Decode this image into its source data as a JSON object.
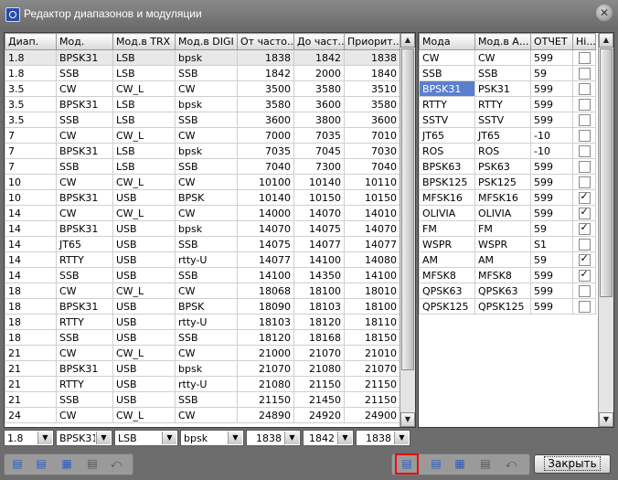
{
  "window": {
    "title": "Редактор диапазонов и модуляции"
  },
  "left_table": {
    "columns": [
      "Диап.",
      "Мод.",
      "Мод.в TRX",
      "Мод.в DIGI",
      "От часто...",
      "До част...",
      "Приорит..."
    ],
    "rows": [
      [
        "1.8",
        "BPSK31",
        "LSB",
        "bpsk",
        "1838",
        "1842",
        "1838"
      ],
      [
        "1.8",
        "SSB",
        "LSB",
        "SSB",
        "1842",
        "2000",
        "1840"
      ],
      [
        "3.5",
        "CW",
        "CW_L",
        "CW",
        "3500",
        "3580",
        "3510"
      ],
      [
        "3.5",
        "BPSK31",
        "LSB",
        "bpsk",
        "3580",
        "3600",
        "3580"
      ],
      [
        "3.5",
        "SSB",
        "LSB",
        "SSB",
        "3600",
        "3800",
        "3600"
      ],
      [
        "7",
        "CW",
        "CW_L",
        "CW",
        "7000",
        "7035",
        "7010"
      ],
      [
        "7",
        "BPSK31",
        "LSB",
        "bpsk",
        "7035",
        "7045",
        "7030"
      ],
      [
        "7",
        "SSB",
        "LSB",
        "SSB",
        "7040",
        "7300",
        "7040"
      ],
      [
        "10",
        "CW",
        "CW_L",
        "CW",
        "10100",
        "10140",
        "10110"
      ],
      [
        "10",
        "BPSK31",
        "USB",
        "BPSK",
        "10140",
        "10150",
        "10150"
      ],
      [
        "14",
        "CW",
        "CW_L",
        "CW",
        "14000",
        "14070",
        "14010"
      ],
      [
        "14",
        "BPSK31",
        "USB",
        "bpsk",
        "14070",
        "14075",
        "14070"
      ],
      [
        "14",
        "JT65",
        "USB",
        "SSB",
        "14075",
        "14077",
        "14077"
      ],
      [
        "14",
        "RTTY",
        "USB",
        "rtty-U",
        "14077",
        "14100",
        "14080"
      ],
      [
        "14",
        "SSB",
        "USB",
        "SSB",
        "14100",
        "14350",
        "14100"
      ],
      [
        "18",
        "CW",
        "CW_L",
        "CW",
        "18068",
        "18100",
        "18010"
      ],
      [
        "18",
        "BPSK31",
        "USB",
        "BPSK",
        "18090",
        "18103",
        "18100"
      ],
      [
        "18",
        "RTTY",
        "USB",
        "rtty-U",
        "18103",
        "18120",
        "18110"
      ],
      [
        "18",
        "SSB",
        "USB",
        "SSB",
        "18120",
        "18168",
        "18150"
      ],
      [
        "21",
        "CW",
        "CW_L",
        "CW",
        "21000",
        "21070",
        "21010"
      ],
      [
        "21",
        "BPSK31",
        "USB",
        "bpsk",
        "21070",
        "21080",
        "21070"
      ],
      [
        "21",
        "RTTY",
        "USB",
        "rtty-U",
        "21080",
        "21150",
        "21150"
      ],
      [
        "21",
        "SSB",
        "USB",
        "SSB",
        "21150",
        "21450",
        "21150"
      ],
      [
        "24",
        "CW",
        "CW_L",
        "CW",
        "24890",
        "24920",
        "24900"
      ]
    ],
    "edit_row": {
      "band": "1.8",
      "mode": "BPSK31",
      "trx_mode": "LSB",
      "digi_mode": "bpsk",
      "from": "1838",
      "to": "1842",
      "priority": "1838"
    }
  },
  "right_table": {
    "columns": [
      "Мода",
      "Мод.в А...",
      "ОТЧЕТ",
      "Hi..."
    ],
    "rows": [
      {
        "mode": "CW",
        "alias": "CW",
        "report": "599",
        "checked": false
      },
      {
        "mode": "SSB",
        "alias": "SSB",
        "report": "59",
        "checked": false
      },
      {
        "mode": "BPSK31",
        "alias": "PSK31",
        "report": "599",
        "checked": false
      },
      {
        "mode": "RTTY",
        "alias": "RTTY",
        "report": "599",
        "checked": false
      },
      {
        "mode": "SSTV",
        "alias": "SSTV",
        "report": "599",
        "checked": false
      },
      {
        "mode": "JT65",
        "alias": "JT65",
        "report": "-10",
        "checked": false
      },
      {
        "mode": "ROS",
        "alias": "ROS",
        "report": "-10",
        "checked": false
      },
      {
        "mode": "BPSK63",
        "alias": "PSK63",
        "report": "599",
        "checked": false
      },
      {
        "mode": "BPSK125",
        "alias": "PSK125",
        "report": "599",
        "checked": false
      },
      {
        "mode": "MFSK16",
        "alias": "MFSK16",
        "report": "599",
        "checked": true
      },
      {
        "mode": "OLIVIA",
        "alias": "OLIVIA",
        "report": "599",
        "checked": true
      },
      {
        "mode": "FM",
        "alias": "FM",
        "report": "59",
        "checked": true
      },
      {
        "mode": "WSPR",
        "alias": "WSPR",
        "report": "S1",
        "checked": false
      },
      {
        "mode": "AM",
        "alias": "AM",
        "report": "59",
        "checked": true
      },
      {
        "mode": "MFSK8",
        "alias": "MFSK8",
        "report": "599",
        "checked": true
      },
      {
        "mode": "QPSK63",
        "alias": "QPSK63",
        "report": "599",
        "checked": false
      },
      {
        "mode": "QPSK125",
        "alias": "QPSK125",
        "report": "599",
        "checked": false
      }
    ]
  },
  "buttons": {
    "close_label": "Закрыть"
  },
  "icons": {
    "add": "add-record-icon",
    "remove": "remove-record-icon",
    "table": "table-icon",
    "save": "save-icon",
    "undo": "undo-icon"
  }
}
